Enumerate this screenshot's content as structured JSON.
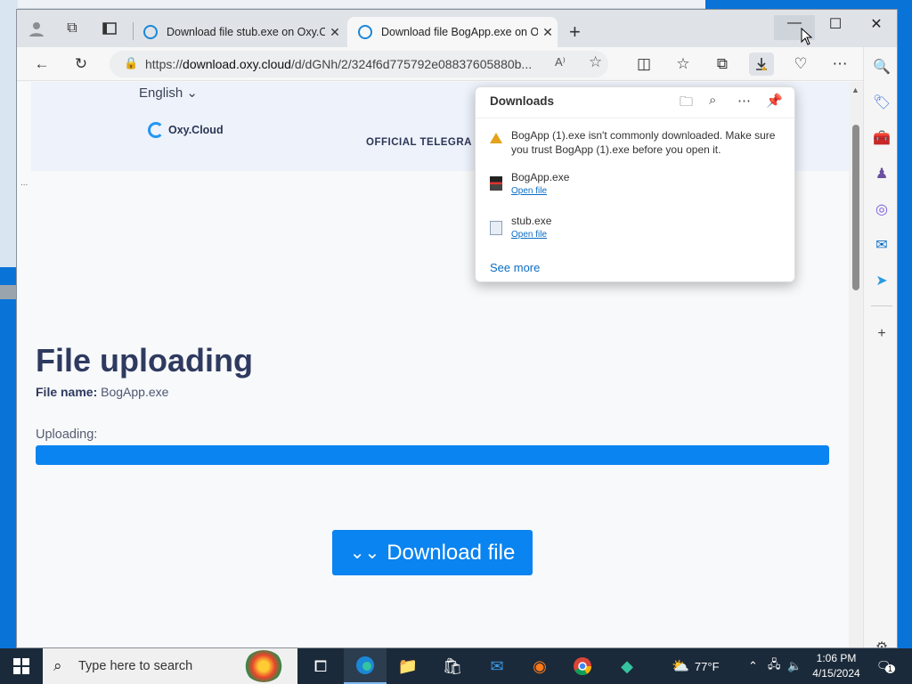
{
  "browser": {
    "tabs": [
      {
        "title": "Download file stub.exe on Oxy.Cl",
        "active": false
      },
      {
        "title": "Download file BogApp.exe on Ox",
        "active": true
      }
    ],
    "address": {
      "prefix": "https://",
      "host": "download.oxy.cloud",
      "path": "/d/dGNh/2/324f6d775792e08837605880b..."
    }
  },
  "page": {
    "language": "English",
    "logo_text": "Oxy.Cloud",
    "official": "OFFICIAL TELEGRA",
    "heading": "File uploading",
    "file_name_label": "File name:",
    "file_name": "BogApp.exe",
    "uploading_label": "Uploading:",
    "progress_fraction": 1.0,
    "download_button": "Download file"
  },
  "downloads": {
    "title": "Downloads",
    "warning": "BogApp (1).exe isn't commonly downloaded. Make sure you trust BogApp (1).exe before you open it.",
    "items": [
      {
        "name": "BogApp.exe",
        "action": "Open file"
      },
      {
        "name": "stub.exe",
        "action": "Open file"
      }
    ],
    "see_more": "See more"
  },
  "taskbar": {
    "search_placeholder": "Type here to search",
    "weather": "77°F",
    "time": "1:06 PM",
    "date": "4/15/2024",
    "notification_count": "1"
  },
  "colors": {
    "accent": "#0a84f0",
    "heading": "#2e3a5f",
    "warning": "#e3a21a"
  }
}
